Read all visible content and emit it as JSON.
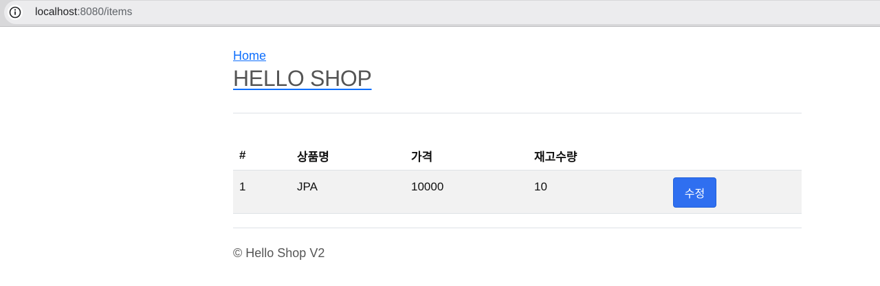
{
  "browser": {
    "url_host": "localhost",
    "url_rest": ":8080/items",
    "info_icon": "info-icon"
  },
  "nav": {
    "home_link": "Home",
    "brand_title": "HELLO SHOP"
  },
  "table": {
    "headers": [
      "#",
      "상품명",
      "가격",
      "재고수량",
      ""
    ],
    "rows": [
      {
        "id": "1",
        "name": "JPA",
        "price": "10000",
        "stock": "10",
        "action_label": "수정"
      }
    ]
  },
  "footer": {
    "text": "© Hello Shop V2"
  },
  "colors": {
    "primary": "#0d6efd",
    "edit_button": "#2f6ff0"
  }
}
